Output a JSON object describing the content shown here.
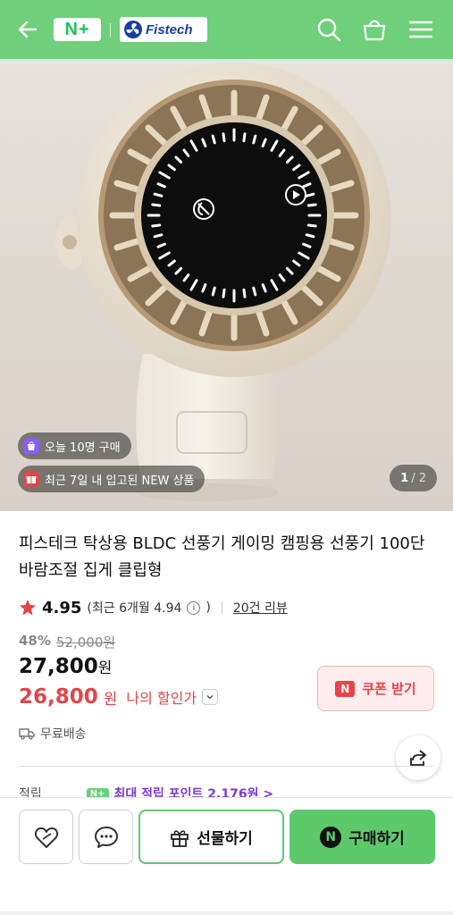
{
  "header": {
    "back_icon": "arrow-left-icon",
    "nplus_label": "N+",
    "brand_name": "Fistech",
    "icons": [
      "search-icon",
      "shopping-bag-icon",
      "menu-icon"
    ],
    "bg_color": "#6fcf7a"
  },
  "hero": {
    "badges": [
      {
        "text": "오늘 10명 구매",
        "icon": "bag-icon",
        "icon_color": "#8b5cf6"
      },
      {
        "text": "최근 7일 내 입고된 NEW 상품",
        "icon": "gift-icon",
        "icon_color": "#e2454a"
      }
    ],
    "counter_current": "1",
    "counter_total": "/ 2"
  },
  "product": {
    "title": "피스테크 탁상용 BLDC 선풍기 게이밍 캠핑용 선풍기 100단 바람조절 집게 클립형",
    "rating": "4.95",
    "recent_rating": "(최근 6개월 4.94",
    "recent_close": ")",
    "review_count": "20건 리뷰",
    "discount_rate": "48%",
    "original_price": "52,000원",
    "price": "27,800",
    "price_unit": "원",
    "my_price": "26,800",
    "my_price_unit": "원",
    "my_price_label": "나의 할인가",
    "coupon_label": "쿠폰 받기",
    "shipping": "무료배송",
    "points_label": "적립",
    "points_promo": "최대 적립 포인트 2,176원 >",
    "accent_red": "#e2454a",
    "accent_green": "#5ec96b"
  },
  "bottom_bar": {
    "gift_label": "선물하기",
    "buy_label": "구매하기",
    "buy_icon_letter": "N"
  }
}
